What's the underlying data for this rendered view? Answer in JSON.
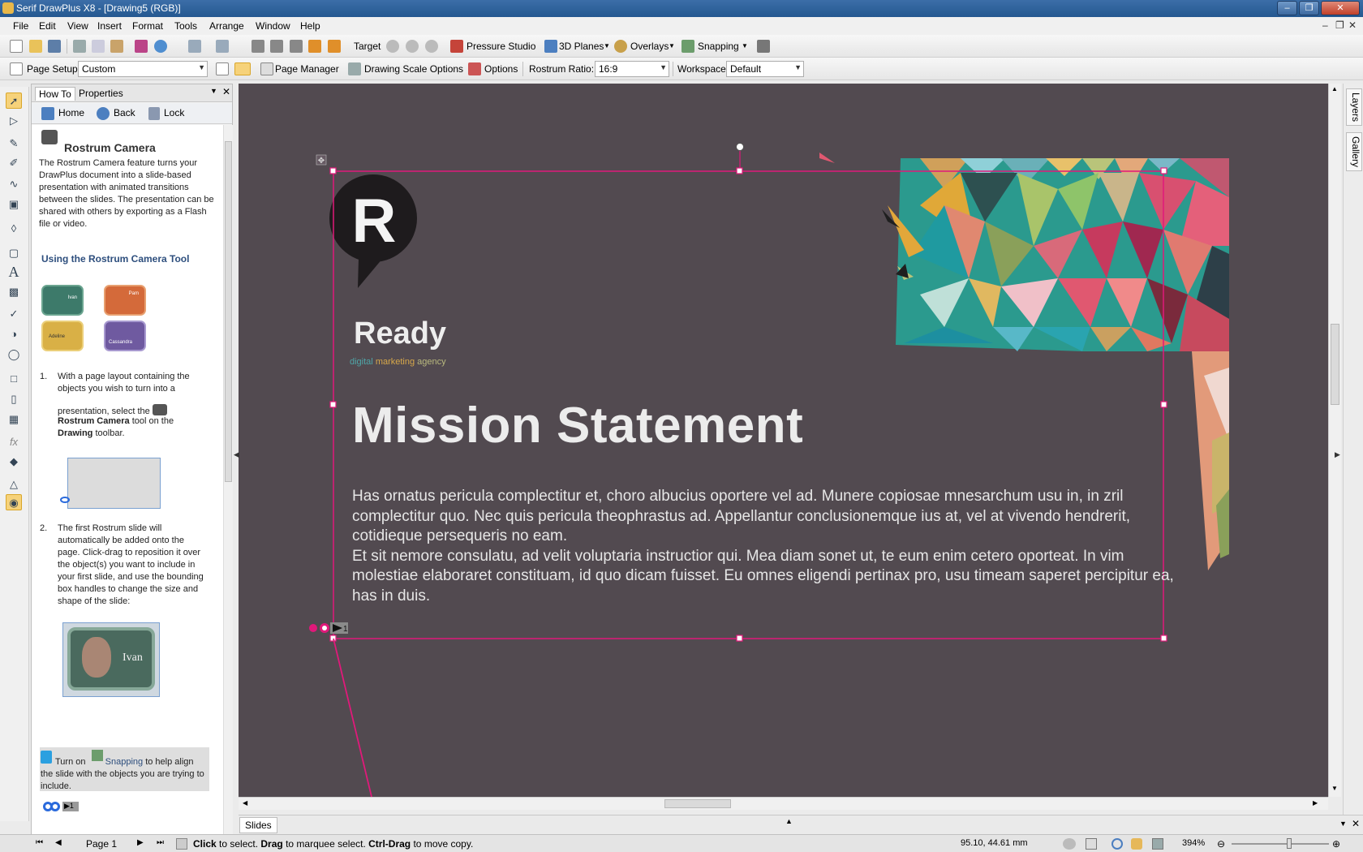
{
  "window": {
    "title": "Serif DrawPlus X8 - [Drawing5 (RGB)]"
  },
  "menu": [
    "File",
    "Edit",
    "View",
    "Insert",
    "Format",
    "Tools",
    "Arrange",
    "Window",
    "Help"
  ],
  "toolbar1": {
    "target": "Target",
    "pressure_studio": "Pressure Studio",
    "planes": "3D Planes",
    "overlays": "Overlays",
    "snapping": "Snapping"
  },
  "toolbar2": {
    "page_setup": "Page Setup",
    "page_setup_value": "Custom",
    "page_manager": "Page Manager",
    "drawing_scale": "Drawing Scale Options",
    "options": "Options",
    "rostrum_ratio_label": "Rostrum Ratio:",
    "rostrum_ratio_value": "16:9",
    "workspace_label": "Workspace",
    "workspace_value": "Default"
  },
  "howto": {
    "tabs": [
      "How To",
      "Properties"
    ],
    "nav": {
      "home": "Home",
      "back": "Back",
      "lock": "Lock"
    },
    "title": "Rostrum Camera",
    "intro": "The Rostrum Camera feature turns your DrawPlus document into a slide-based presentation with animated transitions between the slides. The presentation can be shared with others by exporting as a Flash file or video.",
    "subtitle": "Using the Rostrum Camera Tool",
    "thumb_names": [
      "Ivan",
      "Pam",
      "Adeline",
      "Cassandra"
    ],
    "step1_num": "1.",
    "step1_a": "With a page layout containing the objects you wish to turn into a",
    "step1_b": "presentation, select the",
    "step1_c": "Rostrum Camera",
    "step1_d": "tool on the",
    "step1_e": "Drawing",
    "step1_f": "toolbar.",
    "step2_num": "2.",
    "step2": "The first Rostrum slide will automatically be added onto the page. Click-drag to reposition it over the object(s) you want to include in your first slide, and use the bounding box handles to change the size and shape of the slide:",
    "ivan_label": "Ivan",
    "tip_a": "Turn on",
    "tip_b": "Snapping",
    "tip_c": "to help align the slide with the objects you are trying to include."
  },
  "slide": {
    "logo_letter": "R",
    "brand": "Ready",
    "tagline": [
      "digital",
      "marketing",
      "agency"
    ],
    "tagline_colors": [
      "#4fa6a8",
      "#d7a84a",
      "#b9b97e"
    ],
    "heading": "Mission Statement",
    "body": "Has ornatus pericula complectitur et, choro albucius oportere vel ad. Munere copiosae mnesarchum usu in, in zril complectitur quo. Nec quis pericula theophrastus ad. Appellantur conclusionemque ius at, vel at vivendo hendrerit, cotidieque persequeris no eam.\nEt sit nemore consulatu, ad velit voluptaria instructior qui. Mea diam sonet ut, te eum enim cetero oporteat. In vim molestiae elaboraret constituam, id quo dicam fuisset. Eu omnes eligendi pertinax pro, usu timeam saperet percipitur ea, has in duis.",
    "slide_number": "1"
  },
  "right_tabs": [
    "Layers",
    "Gallery"
  ],
  "slides_panel": {
    "label": "Slides"
  },
  "status": {
    "page": "Page 1",
    "hint_click": "Click",
    "hint_1": " to select. ",
    "hint_drag": "Drag",
    "hint_2": " to marquee select. ",
    "hint_ctrl": "Ctrl-Drag",
    "hint_3": " to move copy.",
    "coords": "95.10, 44.61 mm",
    "zoom": "394%"
  },
  "colors": {
    "canvas": "#524a50",
    "slide_frame": "#e0197a",
    "text_light": "#ececec"
  }
}
